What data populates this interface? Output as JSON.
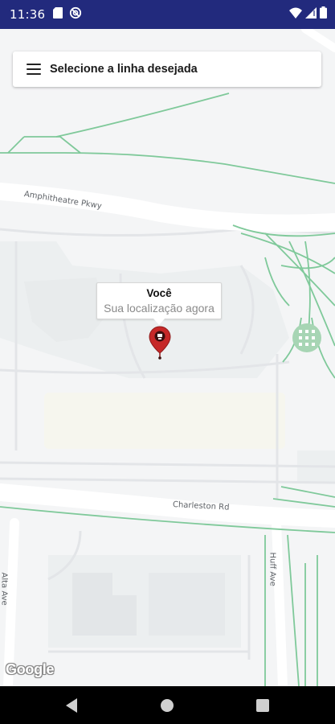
{
  "status_bar": {
    "time": "11:36",
    "left_icons": [
      "sd-card-icon",
      "no-sync-icon"
    ],
    "right_icons": [
      "wifi-icon",
      "signal-icon",
      "battery-icon"
    ],
    "background": "#222a7d"
  },
  "search": {
    "menu_icon": "hamburger-menu-icon",
    "label": "Selecione a linha desejada"
  },
  "map": {
    "roads": {
      "amphitheatre": "Amphitheatre Pkwy",
      "charleston": "Charleston Rd",
      "alta": "Alta Ave",
      "huff": "Huff Ave"
    },
    "info_window": {
      "title": "Você",
      "snippet": "Sua localização agora"
    },
    "marker_icon": "map-pin-icon",
    "marker_color": "#c62828",
    "attribution": "Google"
  },
  "nav_bar": {
    "back_icon": "back-triangle-icon",
    "home_icon": "home-circle-icon",
    "recents_icon": "recents-square-icon"
  }
}
